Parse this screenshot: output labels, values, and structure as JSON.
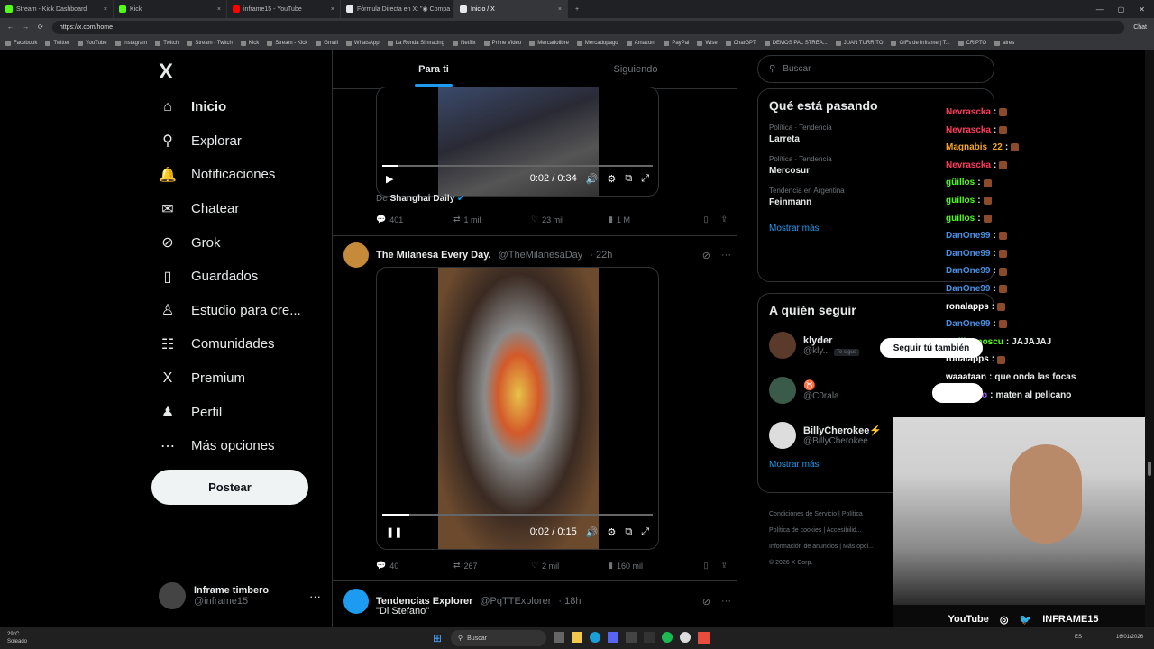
{
  "browser": {
    "tabs": [
      {
        "title": "Stream - Kick Dashboard",
        "color": "#53fc18"
      },
      {
        "title": "Kick",
        "color": "#53fc18"
      },
      {
        "title": "inframe15 - YouTube",
        "color": "#ff0000"
      },
      {
        "title": "Fórmula Directa en X: \"◉ Compa",
        "color": "#e7e9ea"
      },
      {
        "title": "Inicio / X",
        "color": "#e7e9ea"
      }
    ],
    "url": "https://x.com/home",
    "chat_label": "Chat",
    "bookmarks": [
      "Facebook",
      "Twitter",
      "YouTube",
      "Instagram",
      "Twitch",
      "Stream - Twitch",
      "Kick",
      "Stream - Kick",
      "Gmail",
      "WhatsApp",
      "La Ronda Simracing",
      "Netflix",
      "Prime Video",
      "Mercadolibre",
      "Mercadopago",
      "Amazon.",
      "PayPal",
      "Wise",
      "ChatGPT",
      "DEMOS PAL STREA...",
      "JUAN TURRITO",
      "GIFs de Inframe | T...",
      "CRIPTO",
      "aires"
    ]
  },
  "nav": {
    "logo": "X",
    "items": [
      {
        "label": "Inicio",
        "icon": "home-icon",
        "glyph": "⌂"
      },
      {
        "label": "Explorar",
        "icon": "search-icon",
        "glyph": "⚲"
      },
      {
        "label": "Notificaciones",
        "icon": "bell-icon",
        "glyph": "🔔"
      },
      {
        "label": "Chatear",
        "icon": "mail-icon",
        "glyph": "✉"
      },
      {
        "label": "Grok",
        "icon": "grok-icon",
        "glyph": "⊘"
      },
      {
        "label": "Guardados",
        "icon": "bookmark-icon",
        "glyph": "▯"
      },
      {
        "label": "Estudio para cre...",
        "icon": "studio-icon",
        "glyph": "♙"
      },
      {
        "label": "Comunidades",
        "icon": "communities-icon",
        "glyph": "☷"
      },
      {
        "label": "Premium",
        "icon": "x-premium-icon",
        "glyph": "X"
      },
      {
        "label": "Perfil",
        "icon": "profile-icon",
        "glyph": "♟"
      },
      {
        "label": "Más opciones",
        "icon": "more-options-icon",
        "glyph": "⋯"
      }
    ],
    "post_button": "Postear",
    "profile": {
      "name": "Inframe timbero",
      "handle": "@inframe15"
    }
  },
  "feed": {
    "tabs": [
      "Para ti",
      "Siguiendo"
    ],
    "video1": {
      "time": "0:02 / 0:34",
      "progress": 0.06
    },
    "source_prefix": "De",
    "source_name": "Shanghai Daily",
    "post1_stats": {
      "replies": "401",
      "reposts": "1 mil",
      "likes": "23 mil",
      "views": "1 M"
    },
    "post2": {
      "name": "The Milanesa Every Day.",
      "handle": "@TheMilanesaDay",
      "time": "· 22h"
    },
    "video2": {
      "time": "0:02 / 0:15",
      "progress": 0.1
    },
    "post2_stats": {
      "replies": "40",
      "reposts": "267",
      "likes": "2 mil",
      "views": "160 mil"
    },
    "post3": {
      "name": "Tendencias Explorer",
      "handle": "@PqTTExplorer",
      "time": "· 18h",
      "text": "\"Di Stefano\""
    }
  },
  "sidebar": {
    "search_placeholder": "Buscar",
    "trends_title": "Qué está pasando",
    "trends": [
      {
        "meta": "Política · Tendencia",
        "name": "Larreta"
      },
      {
        "meta": "Política · Tendencia",
        "name": "Mercosur"
      },
      {
        "meta": "Tendencia en Argentina",
        "name": "Feinmann"
      }
    ],
    "show_more": "Mostrar más",
    "follow_title": "A quién seguir",
    "follow": [
      {
        "name": "klyder",
        "handle": "@kly...",
        "badge": "Te sigue"
      },
      {
        "name": "♉",
        "handle": "@C0rala",
        "badge": ""
      },
      {
        "name": "BillyCherokee⚡",
        "handle": "@BillyCherokee",
        "badge": ""
      }
    ],
    "footer": [
      "Condiciones de Servicio",
      "Política",
      "Política de cookies",
      "Accesibilid...",
      "Información de anuncios",
      "Más opci...",
      "© 2026 X Corp."
    ]
  },
  "chat": {
    "lines": [
      {
        "user": "Nevrascka",
        "msg": "",
        "color": "#ff3b5c"
      },
      {
        "user": "Nevrascka",
        "msg": "",
        "color": "#ff3b5c"
      },
      {
        "user": "Magnabis_22",
        "msg": "",
        "color": "#f5a623"
      },
      {
        "user": "Nevrascka",
        "msg": "",
        "color": "#ff3b5c"
      },
      {
        "user": "güillos",
        "msg": "",
        "color": "#53fc18"
      },
      {
        "user": "güillos",
        "msg": "",
        "color": "#53fc18"
      },
      {
        "user": "güillos",
        "msg": "",
        "color": "#53fc18"
      },
      {
        "user": "DanOne99",
        "msg": "",
        "color": "#4a90e2"
      },
      {
        "user": "DanOne99",
        "msg": "",
        "color": "#4a90e2"
      },
      {
        "user": "DanOne99",
        "msg": "",
        "color": "#4a90e2"
      },
      {
        "user": "DanOne99",
        "msg": "",
        "color": "#4a90e2"
      },
      {
        "user": "ronalapps",
        "msg": "",
        "color": "#ffffff"
      },
      {
        "user": "DanOne99",
        "msg": "",
        "color": "#4a90e2"
      },
      {
        "user": "Guillermoscu",
        "msg": "JAJAJAJ",
        "color": "#53fc18"
      },
      {
        "user": "ronalapps",
        "msg": "",
        "color": "#ffffff"
      },
      {
        "user": "waaataan",
        "msg": "que onda las focas",
        "color": "#ffffff"
      },
      {
        "user": "CrewFero",
        "msg": "maten al pelicano",
        "color": "#9b59ff"
      }
    ],
    "follow_popup": "Seguir tú también"
  },
  "webcam": {
    "youtube": "YouTube",
    "brand": "INFRAME15"
  },
  "taskbar": {
    "weather_temp": "29°C",
    "weather_desc": "Soleado",
    "search": "Buscar",
    "lang": "ES",
    "date": "16/01/2026"
  }
}
